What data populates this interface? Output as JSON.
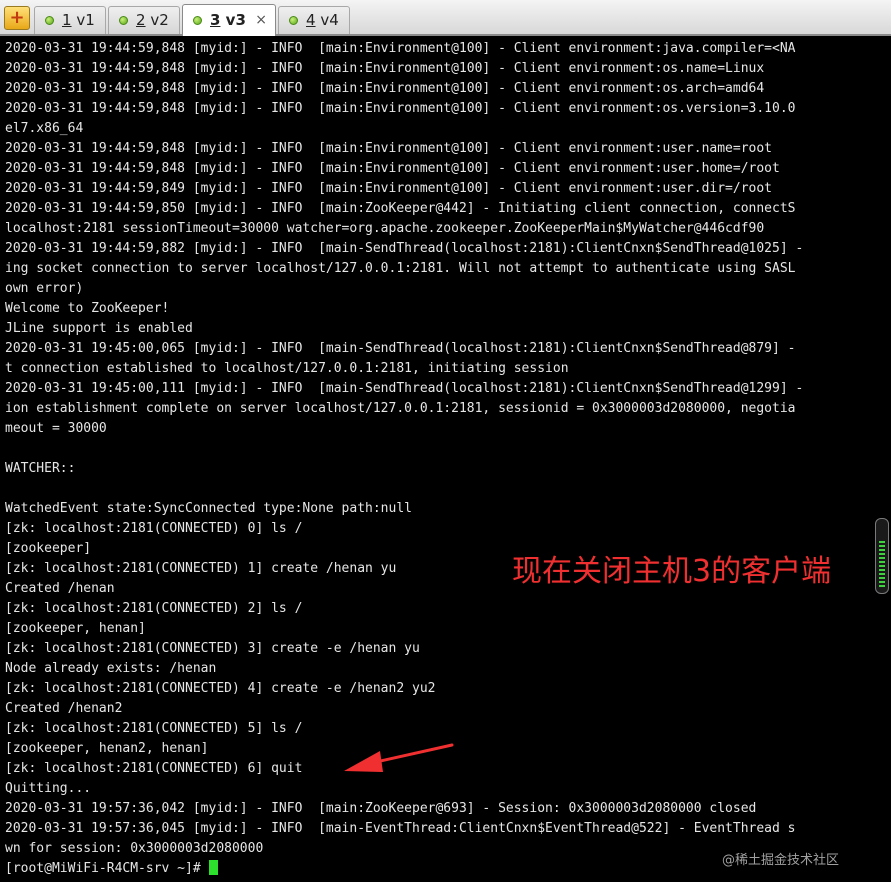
{
  "tabs": [
    {
      "number": "1",
      "label": "v1"
    },
    {
      "number": "2",
      "label": "v2"
    },
    {
      "number": "3",
      "label": "v3"
    },
    {
      "number": "4",
      "label": "v4"
    }
  ],
  "active_tab_close": "×",
  "terminal": {
    "lines": [
      "2020-03-31 19:44:59,848 [myid:] - INFO  [main:Environment@100] - Client environment:java.compiler=<NA",
      "2020-03-31 19:44:59,848 [myid:] - INFO  [main:Environment@100] - Client environment:os.name=Linux",
      "2020-03-31 19:44:59,848 [myid:] - INFO  [main:Environment@100] - Client environment:os.arch=amd64",
      "2020-03-31 19:44:59,848 [myid:] - INFO  [main:Environment@100] - Client environment:os.version=3.10.0",
      "el7.x86_64",
      "2020-03-31 19:44:59,848 [myid:] - INFO  [main:Environment@100] - Client environment:user.name=root",
      "2020-03-31 19:44:59,848 [myid:] - INFO  [main:Environment@100] - Client environment:user.home=/root",
      "2020-03-31 19:44:59,849 [myid:] - INFO  [main:Environment@100] - Client environment:user.dir=/root",
      "2020-03-31 19:44:59,850 [myid:] - INFO  [main:ZooKeeper@442] - Initiating client connection, connectS",
      "localhost:2181 sessionTimeout=30000 watcher=org.apache.zookeeper.ZooKeeperMain$MyWatcher@446cdf90",
      "2020-03-31 19:44:59,882 [myid:] - INFO  [main-SendThread(localhost:2181):ClientCnxn$SendThread@1025] -",
      "ing socket connection to server localhost/127.0.0.1:2181. Will not attempt to authenticate using SASL",
      "own error)",
      "Welcome to ZooKeeper!",
      "JLine support is enabled",
      "2020-03-31 19:45:00,065 [myid:] - INFO  [main-SendThread(localhost:2181):ClientCnxn$SendThread@879] -",
      "t connection established to localhost/127.0.0.1:2181, initiating session",
      "2020-03-31 19:45:00,111 [myid:] - INFO  [main-SendThread(localhost:2181):ClientCnxn$SendThread@1299] -",
      "ion establishment complete on server localhost/127.0.0.1:2181, sessionid = 0x3000003d2080000, negotia",
      "meout = 30000",
      "",
      "WATCHER::",
      "",
      "WatchedEvent state:SyncConnected type:None path:null",
      "[zk: localhost:2181(CONNECTED) 0] ls /",
      "[zookeeper]",
      "[zk: localhost:2181(CONNECTED) 1] create /henan yu",
      "Created /henan",
      "[zk: localhost:2181(CONNECTED) 2] ls /",
      "[zookeeper, henan]",
      "[zk: localhost:2181(CONNECTED) 3] create -e /henan yu",
      "Node already exists: /henan",
      "[zk: localhost:2181(CONNECTED) 4] create -e /henan2 yu2",
      "Created /henan2",
      "[zk: localhost:2181(CONNECTED) 5] ls /",
      "[zookeeper, henan2, henan]",
      "[zk: localhost:2181(CONNECTED) 6] quit",
      "Quitting...",
      "2020-03-31 19:57:36,042 [myid:] - INFO  [main:ZooKeeper@693] - Session: 0x3000003d2080000 closed",
      "2020-03-31 19:57:36,045 [myid:] - INFO  [main-EventThread:ClientCnxn$EventThread@522] - EventThread s",
      "wn for session: 0x3000003d2080000"
    ],
    "prompt": "[root@MiWiFi-R4CM-srv ~]# "
  },
  "annotation": "现在关闭主机3的客户端",
  "watermark": "@稀土掘金技术社区",
  "colors": {
    "terminal_bg": "#000000",
    "terminal_fg": "#e6e6e6",
    "cursor": "#2ee02e",
    "annotation": "#f03030"
  }
}
